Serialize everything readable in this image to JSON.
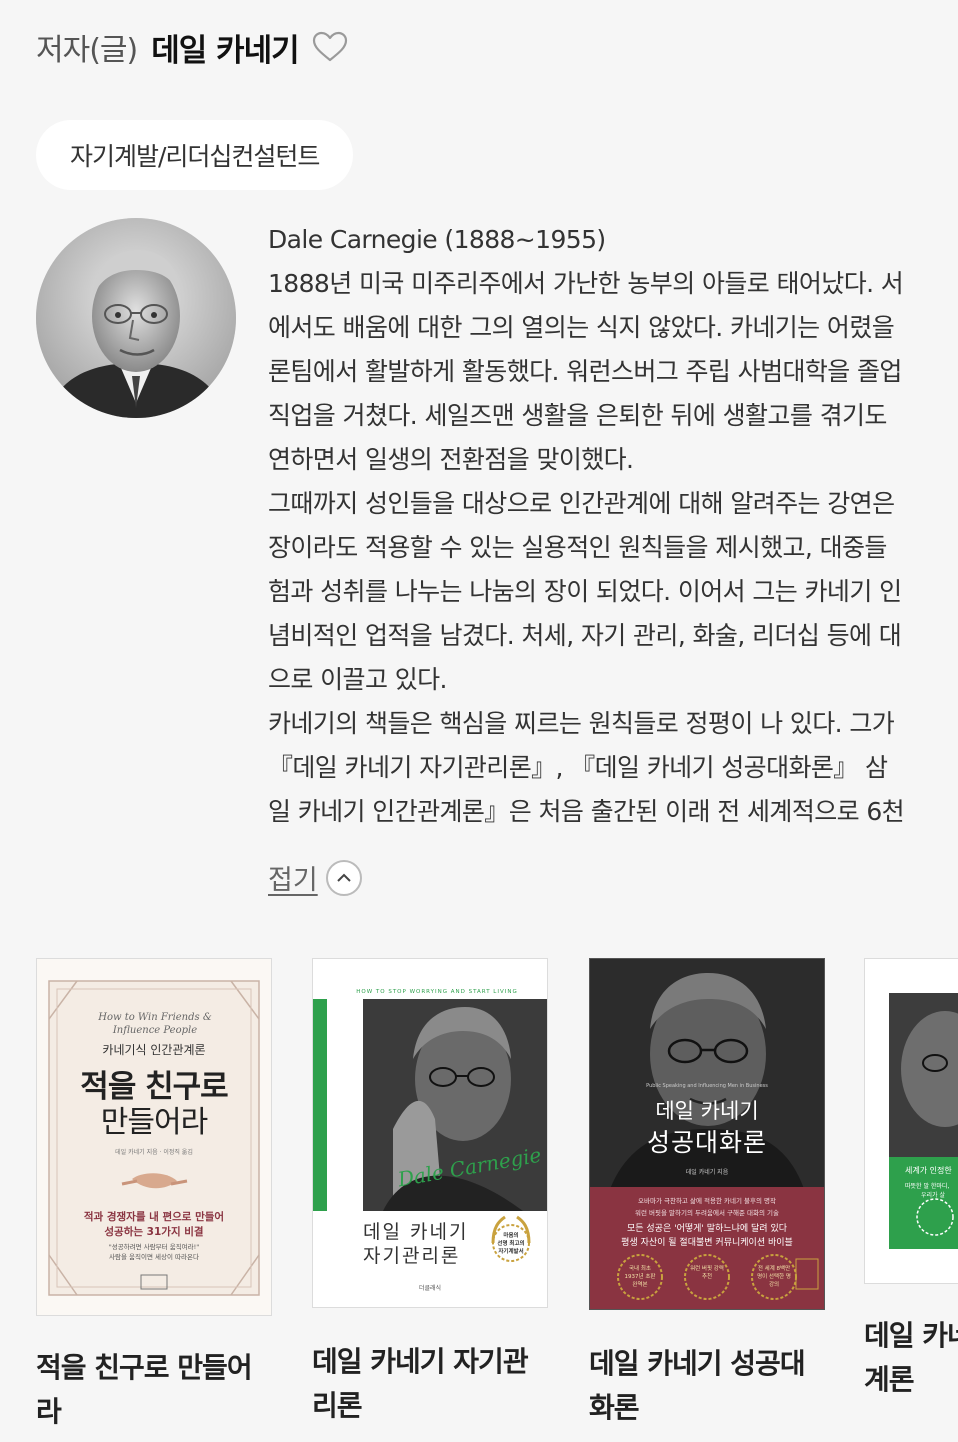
{
  "header": {
    "role_label": "저자(글)",
    "author_name": "데일 카네기"
  },
  "occupation": "자기계발/리더십컨설턴트",
  "bio": {
    "lines": [
      "Dale Carnegie (1888~1955)",
      "1888년 미국 미주리주에서 가난한 농부의 아들로 태어났다. 서",
      "에서도 배움에 대한 그의 열의는 식지 않았다. 카네기는 어렸을",
      "론팀에서 활발하게 활동했다. 워런스버그 주립 사범대학을 졸업",
      "직업을 거쳤다. 세일즈맨 생활을 은퇴한 뒤에 생활고를 겪기도",
      "연하면서 일생의 전환점을 맞이했다.",
      "그때까지 성인들을 대상으로 인간관계에 대해 알려주는 강연은",
      "장이라도 적용할 수 있는 실용적인 원칙들을 제시했고, 대중들",
      "험과 성취를 나누는 나눔의 장이 되었다. 이어서 그는 카네기 인",
      "념비적인 업적을 남겼다. 처세, 자기 관리, 화술, 리더십 등에 대",
      "으로 이끌고 있다.",
      "카네기의 책들은 핵심을 찌르는 원칙들로 정평이 나 있다. 그가",
      "『데일 카네기 자기관리론』, 『데일 카네기 성공대화론』 삼",
      "일 카네기 인간관계론』은 처음 출간된 이래 전 세계적으로 6천"
    ]
  },
  "collapse_label": "접기",
  "books": [
    {
      "title_lines": [
        "적을 친구로 만들어",
        "라"
      ],
      "cover": {
        "script": "How to Win Friends & Influence People",
        "series": "카네기식 인간관계론",
        "main_1": "적을 친구로",
        "main_2": "만들어라",
        "author_line": "데일 카네기 지음 · 이정직 옮김",
        "tag_1": "적과 경쟁자를 내 편으로 만들어",
        "tag_2": "성공하는 31가지 비결",
        "quote_1": "\"성공하려면 사람부터 움직여라!\"",
        "quote_2": "사람을 움직이면 세상이 따라온다"
      }
    },
    {
      "title_lines": [
        "데일 카네기 자기관",
        "리론"
      ],
      "cover": {
        "top_text": "HOW TO STOP WORRYING AND START LIVING",
        "main_1": "데일 카네기",
        "main_2": "자기관리론",
        "signature": "Dale Carnegie",
        "badge_1": "마음의",
        "badge_2": "선명 최고의",
        "badge_3": "자기계발서",
        "publisher": "더클래식"
      }
    },
    {
      "title_lines": [
        "데일 카네기 성공대",
        "화론"
      ],
      "cover": {
        "subtitle": "Public Speaking and Influencing Men in Business",
        "main_1": "데일 카네기",
        "main_2": "성공대화론",
        "author_line": "데일 카네기 지음",
        "desc_1": "오바마가 극찬하고 삶에 적용한 카네기 불후의 명작",
        "desc_2": "워런 버핏을 말하기의 두려움에서 구해준 대화의 기술",
        "desc_3": "모든 성공은 '어떻게' 말하느냐에 달려 있다",
        "desc_4": "평생 자산이 될 절대불변 커뮤니케이션 바이블",
        "laurel_1": "국내 최초 1937년 초판 완역본",
        "laurel_2": "워런 버핏 강력 추천",
        "laurel_3": "전 세계 8백만 명이 선택한 명강의"
      }
    },
    {
      "title_lines": [
        "데일 카네",
        "계론"
      ],
      "cover": {
        "text_1": "세계가 인정한",
        "text_2": "따뜻한 말 한마디,",
        "text_3": "우리가 살"
      }
    }
  ],
  "colors": {
    "background": "#f6f6f6",
    "green": "#2ea04c",
    "maroon": "#8a3441",
    "gold": "#c9a23e"
  }
}
